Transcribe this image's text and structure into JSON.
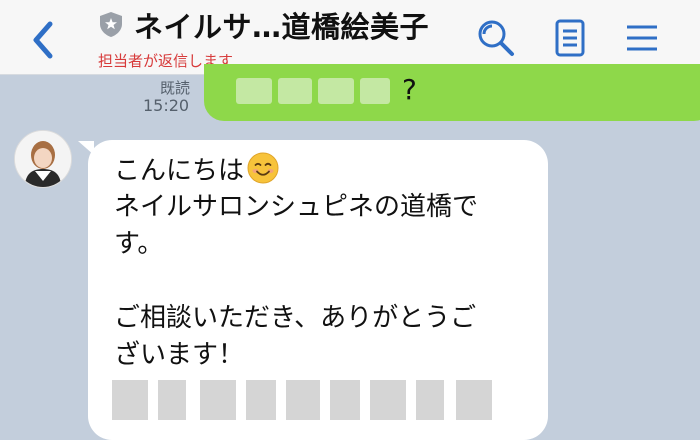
{
  "header": {
    "title": "ネイルサ…道橋絵美子",
    "subtitle": "担当者が返信します",
    "icons": [
      "back-chevron-icon",
      "shield-icon",
      "search-icon",
      "notes-icon",
      "menu-icon"
    ],
    "accent_color": "#2f6fc6",
    "subtitle_color": "#d73a3a"
  },
  "outgoing": {
    "read_label": "既読",
    "time": "15:20",
    "visible_text": "?",
    "bubble_color": "#8ed84a"
  },
  "incoming": {
    "lines": [
      "こんにちは",
      "ネイルサロンシュピネの道橋で",
      "す。",
      "",
      "ご相談いただき、ありがとうご",
      "ざいます！"
    ],
    "emoji": "smiling-face-emoji",
    "bubble_color": "#ffffff"
  }
}
